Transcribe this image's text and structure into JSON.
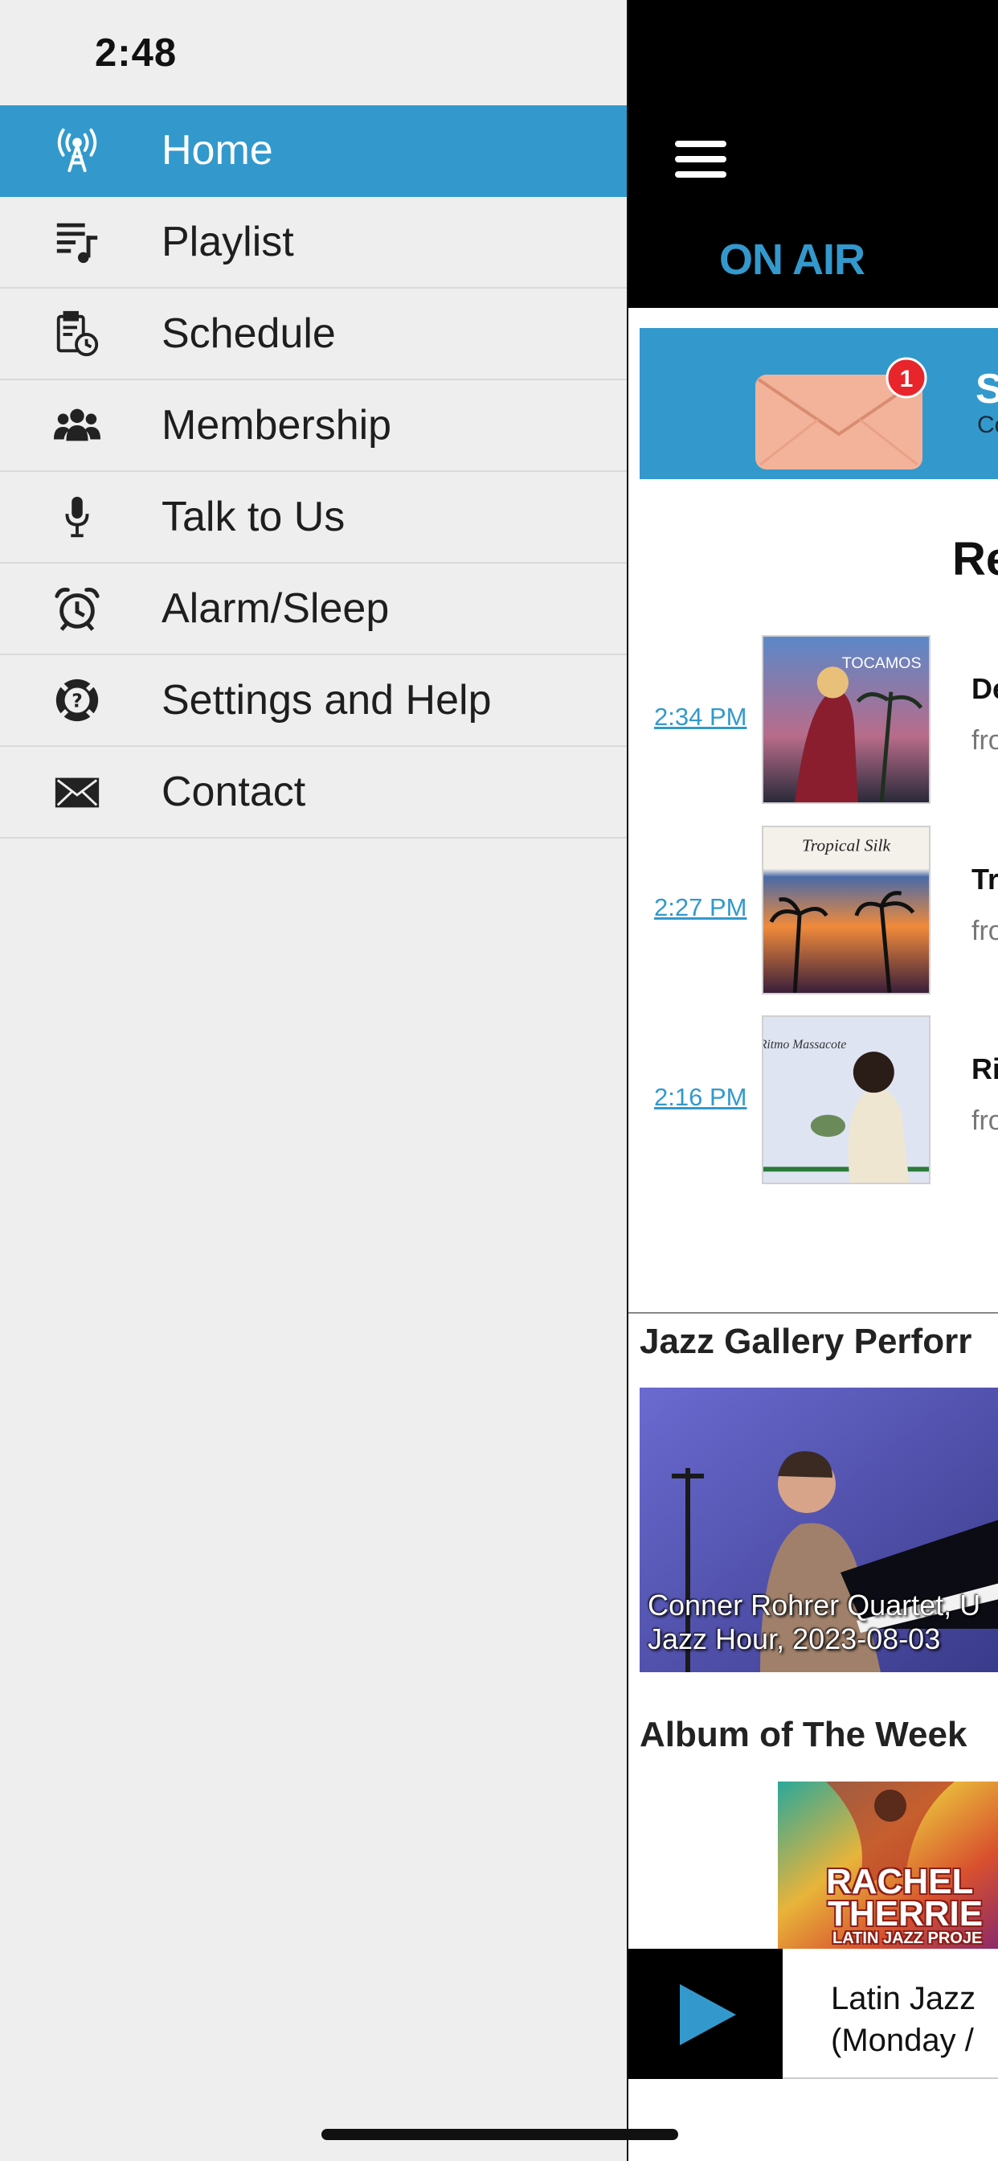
{
  "status_bar": {
    "time": "2:48"
  },
  "menu": {
    "items": [
      {
        "label": "Home",
        "icon": "radio-tower-icon",
        "active": true
      },
      {
        "label": "Playlist",
        "icon": "playlist-icon"
      },
      {
        "label": "Schedule",
        "icon": "schedule-clipboard-icon"
      },
      {
        "label": "Membership",
        "icon": "group-icon"
      },
      {
        "label": "Talk to Us",
        "icon": "microphone-icon"
      },
      {
        "label": "Alarm/Sleep",
        "icon": "alarm-clock-icon"
      },
      {
        "label": "Settings and Help",
        "icon": "help-lifebuoy-icon"
      },
      {
        "label": "Contact",
        "icon": "envelope-icon"
      }
    ]
  },
  "app": {
    "header": {
      "on_air": "ON AIR"
    },
    "subscribe_banner": {
      "title": "SU",
      "text": "Co",
      "badge": "1"
    },
    "recent": {
      "title": "Re",
      "tracks": [
        {
          "time": "2:34 PM",
          "title": "De",
          "from": "fro",
          "art_text": "TOCAMOS"
        },
        {
          "time": "2:27 PM",
          "title": "Tr",
          "from": "fro",
          "art_text": "Tropical Silk"
        },
        {
          "time": "2:16 PM",
          "title": "Ri",
          "from": "fro",
          "art_text": "Ritmo Massacote"
        }
      ]
    },
    "gallery": {
      "title": "Jazz Gallery Perforr",
      "caption_line1": "Conner Rohrer Quartet, U",
      "caption_line2": "Jazz Hour, 2023-08-03"
    },
    "album": {
      "title": "Album of The Week",
      "art_line1": "RACHEL",
      "art_line2": "THERRIE",
      "art_line3": "LATIN JAZZ PROJE"
    },
    "player": {
      "line1": "Latin Jazz",
      "line2": "(Monday /"
    }
  },
  "colors": {
    "accent": "#3399cc",
    "drawer_bg": "#eeeeee",
    "header_bg": "#000000"
  }
}
